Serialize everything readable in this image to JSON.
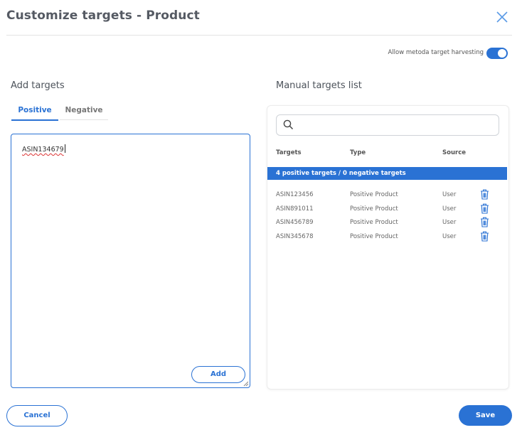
{
  "header": {
    "title": "Customize targets - Product",
    "close_icon": "close-icon"
  },
  "settings": {
    "harvest_label": "Allow metoda target harvesting",
    "harvest_enabled": true
  },
  "add_targets": {
    "title": "Add targets",
    "tabs": [
      {
        "label": "Positive",
        "active": true
      },
      {
        "label": "Negative",
        "active": false
      }
    ],
    "input_value": "ASIN134679",
    "add_label": "Add"
  },
  "manual_list": {
    "title": "Manual targets list",
    "search_icon": "search-icon",
    "columns": [
      "Targets",
      "Type",
      "Source"
    ],
    "summary": "4 positive targets / 0 negative targets",
    "rows": [
      {
        "target": "ASIN123456",
        "type": "Positive Product",
        "source": "User"
      },
      {
        "target": "ASIN891011",
        "type": "Positive Product",
        "source": "User"
      },
      {
        "target": "ASIN456789",
        "type": "Positive Product",
        "source": "User"
      },
      {
        "target": "ASIN345678",
        "type": "Positive Product",
        "source": "User"
      }
    ],
    "delete_icon": "trash-icon"
  },
  "footer": {
    "cancel_label": "Cancel",
    "save_label": "Save"
  },
  "colors": {
    "accent": "#2a72d4",
    "text": "#4a4a4a"
  }
}
